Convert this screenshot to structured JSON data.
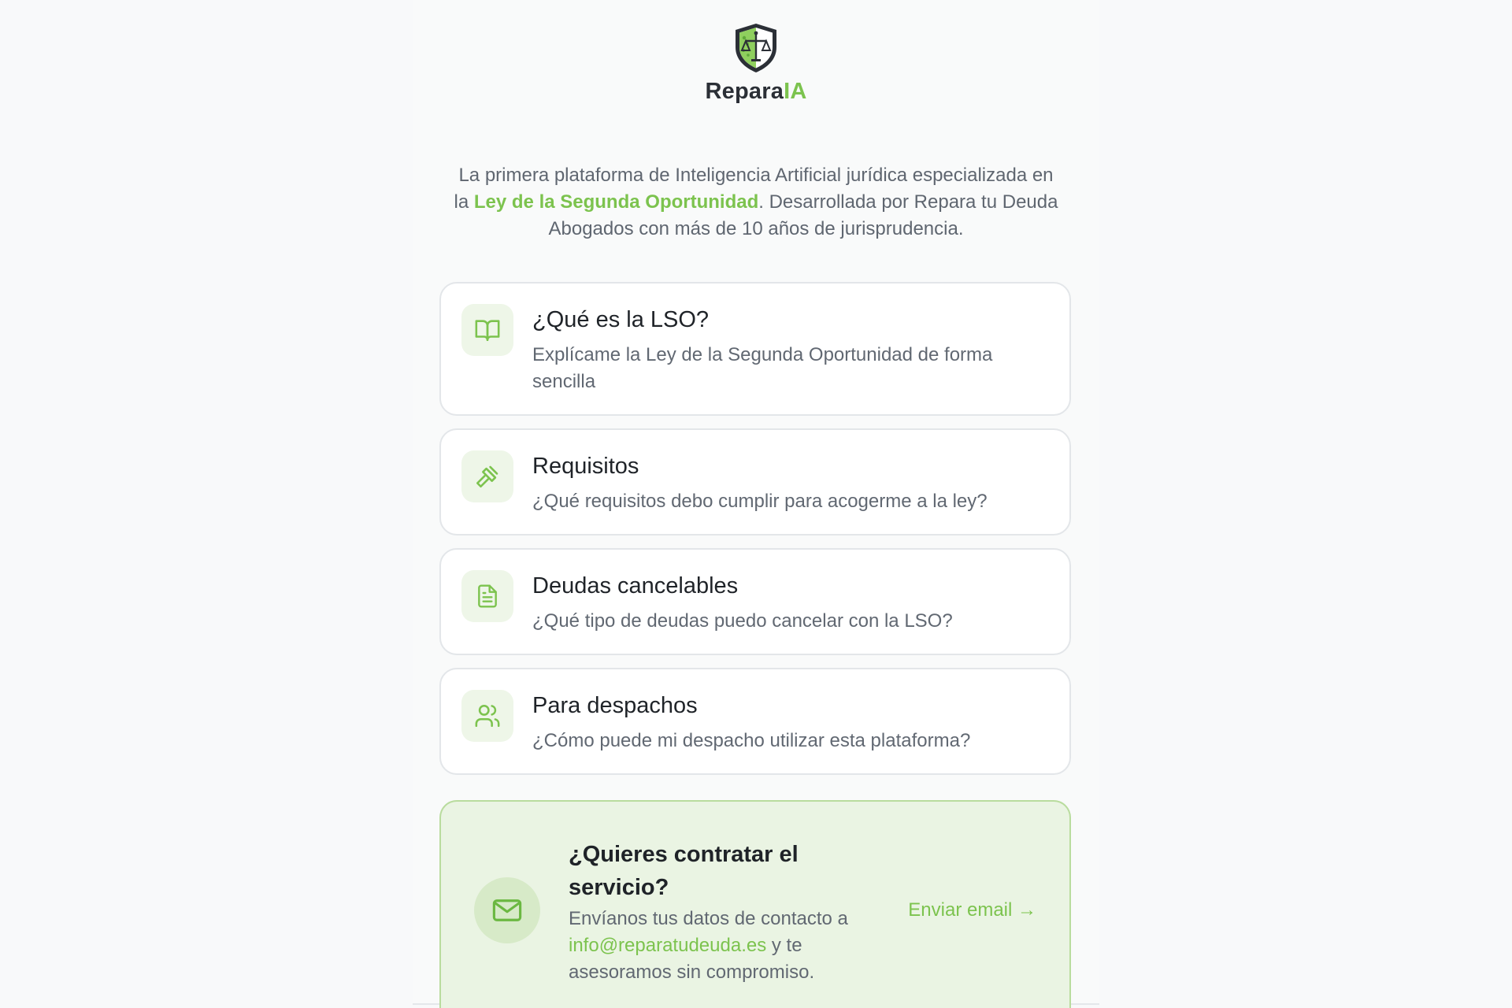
{
  "brand": {
    "name_dark": "Repara",
    "name_green": "IA"
  },
  "intro": {
    "before": "La primera plataforma de Inteligencia Artificial jurídica especializada en la ",
    "highlight": "Ley de la Segunda Oportunidad",
    "after": ". Desarrollada por Repara tu Deuda Abogados con más de 10 años de jurisprudencia."
  },
  "cards": [
    {
      "icon": "book-open-icon",
      "title": "¿Qué es la LSO?",
      "subtitle": "Explícame la Ley de la Segunda Oportunidad de forma sencilla"
    },
    {
      "icon": "gavel-icon",
      "title": "Requisitos",
      "subtitle": "¿Qué requisitos debo cumplir para acogerme a la ley?"
    },
    {
      "icon": "document-icon",
      "title": "Deudas cancelables",
      "subtitle": "¿Qué tipo de deudas puedo cancelar con la LSO?"
    },
    {
      "icon": "users-icon",
      "title": "Para despachos",
      "subtitle": "¿Cómo puede mi despacho utilizar esta plataforma?"
    }
  ],
  "cta": {
    "icon": "mail-icon",
    "title": "¿Quieres contratar el servicio?",
    "text_before": "Envíanos tus datos de contacto a ",
    "email": "info@reparatudeuda.es",
    "text_after": " y te asesoramos sin compromiso.",
    "button_label": "Enviar email →"
  },
  "colors": {
    "accent_green": "#7cc34e",
    "brand_dark": "#2b2f36",
    "cta_background": "#eaf4e3",
    "icon_tile": "#eef6e8"
  }
}
